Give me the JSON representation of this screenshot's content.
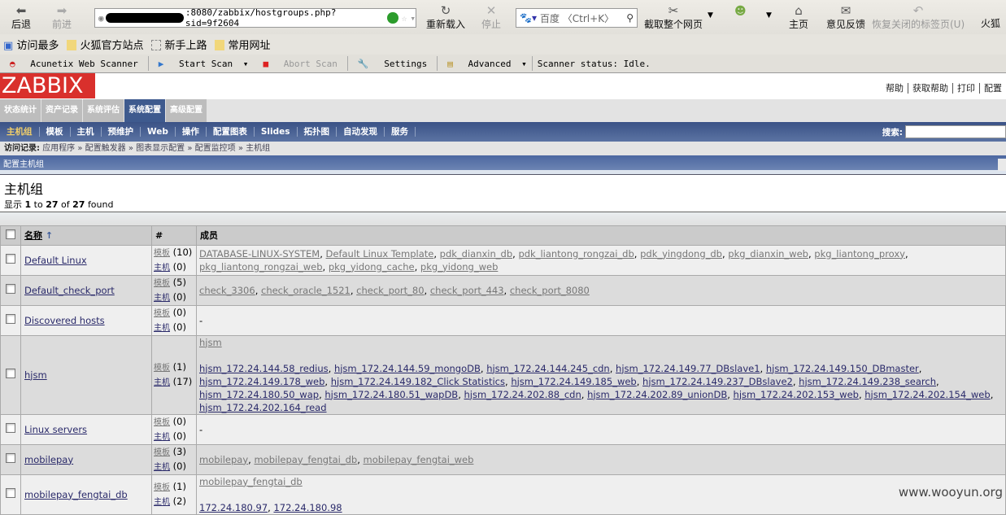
{
  "browser": {
    "back": "后退",
    "forward": "前进",
    "url": ":8080/zabbix/hostgroups.php?sid=9f2604",
    "reload": "重新载入",
    "stop": "停止",
    "search_placeholder": "百度 〈Ctrl+K〉",
    "screenshot": "截取整个网页",
    "home": "主页",
    "feedback": "意见反馈",
    "restore_tabs": "恢复关闭的标签页(U)",
    "firefox": "火狐",
    "bookmarks": [
      "访问最多",
      "火狐官方站点",
      "新手上路",
      "常用网址"
    ],
    "acunetix": {
      "name": "Acunetix Web Scanner",
      "start": "Start Scan",
      "abort": "Abort Scan",
      "settings": "Settings",
      "advanced": "Advanced",
      "status": "Scanner status: Idle."
    }
  },
  "zabbix": {
    "logo": "ZABBIX",
    "top_links": [
      "帮助",
      "获取帮助",
      "打印",
      "配置"
    ],
    "main_tabs": [
      "状态统计",
      "资产记录",
      "系统评估",
      "系统配置",
      "高级配置"
    ],
    "sub_menu": [
      "主机组",
      "模板",
      "主机",
      "预维护",
      "Web",
      "操作",
      "配置图表",
      "Slides",
      "拓扑图",
      "自动发现",
      "服务"
    ],
    "search_label": "搜索:",
    "breadcrumb_label": "访问记录:",
    "breadcrumb": [
      "应用程序",
      "配置触发器",
      "图表显示配置",
      "配置监控项",
      "主机组"
    ],
    "section_title": "配置主机组",
    "page_title": "主机组",
    "found": {
      "prefix": "显示",
      "from": "1",
      "to_word": "to",
      "to": "27",
      "of_word": "of",
      "total": "27",
      "suffix": "found"
    },
    "columns": {
      "name": "名称",
      "count": "#",
      "members": "成员"
    },
    "tpl_label": "模板",
    "host_label": "主机",
    "rows": [
      {
        "name": "Default Linux",
        "templates_count": "(10)",
        "hosts_count": "(0)",
        "templates": [
          "DATABASE-LINUX-SYSTEM",
          "Default Linux Template",
          "pdk_dianxin_db",
          "pdk_liantong_rongzai_db",
          "pdk_yingdong_db",
          "pkg_dianxin_web",
          "pkg_liantong_proxy",
          "pkg_liantong_rongzai_web",
          "pkg_yidong_cache",
          "pkg_yidong_web"
        ],
        "hosts": []
      },
      {
        "name": "Default_check_port",
        "templates_count": "(5)",
        "hosts_count": "(0)",
        "templates": [
          "check_3306",
          "check_oracle_1521",
          "check_port_80",
          "check_port_443",
          "check_port_8080"
        ],
        "hosts": []
      },
      {
        "name": "Discovered hosts",
        "templates_count": "(0)",
        "hosts_count": "(0)",
        "templates": [],
        "hosts": [],
        "empty": "-"
      },
      {
        "name": "hjsm",
        "templates_count": "(1)",
        "hosts_count": "(17)",
        "templates": [
          "hjsm"
        ],
        "hosts": [
          "hjsm_172.24.144.58_redius",
          "hjsm_172.24.144.59_mongoDB",
          "hjsm_172.24.144.245_cdn",
          "hjsm_172.24.149.77_DBslave1",
          "hjsm_172.24.149.150_DBmaster",
          "hjsm_172.24.149.178_web",
          "hjsm_172.24.149.182_Click Statistics",
          "hjsm_172.24.149.185_web",
          "hjsm_172.24.149.237_DBslave2",
          "hjsm_172.24.149.238_search",
          "hjsm_172.24.180.50_wap",
          "hjsm_172.24.180.51_wapDB",
          "hjsm_172.24.202.88_cdn",
          "hjsm_172.24.202.89_unionDB",
          "hjsm_172.24.202.153_web",
          "hjsm_172.24.202.154_web",
          "hjsm_172.24.202.164_read"
        ]
      },
      {
        "name": "Linux servers",
        "templates_count": "(0)",
        "hosts_count": "(0)",
        "templates": [],
        "hosts": [],
        "empty": "-"
      },
      {
        "name": "mobilepay",
        "templates_count": "(3)",
        "hosts_count": "(0)",
        "templates": [
          "mobilepay",
          "mobilepay_fengtai_db",
          "mobilepay_fengtai_web"
        ],
        "hosts": []
      },
      {
        "name": "mobilepay_fengtai_db",
        "templates_count": "(1)",
        "hosts_count": "(2)",
        "templates": [
          "mobilepay_fengtai_db"
        ],
        "hosts": [
          "172.24.180.97",
          "172.24.180.98"
        ]
      }
    ]
  },
  "watermark": "www.wooyun.org"
}
